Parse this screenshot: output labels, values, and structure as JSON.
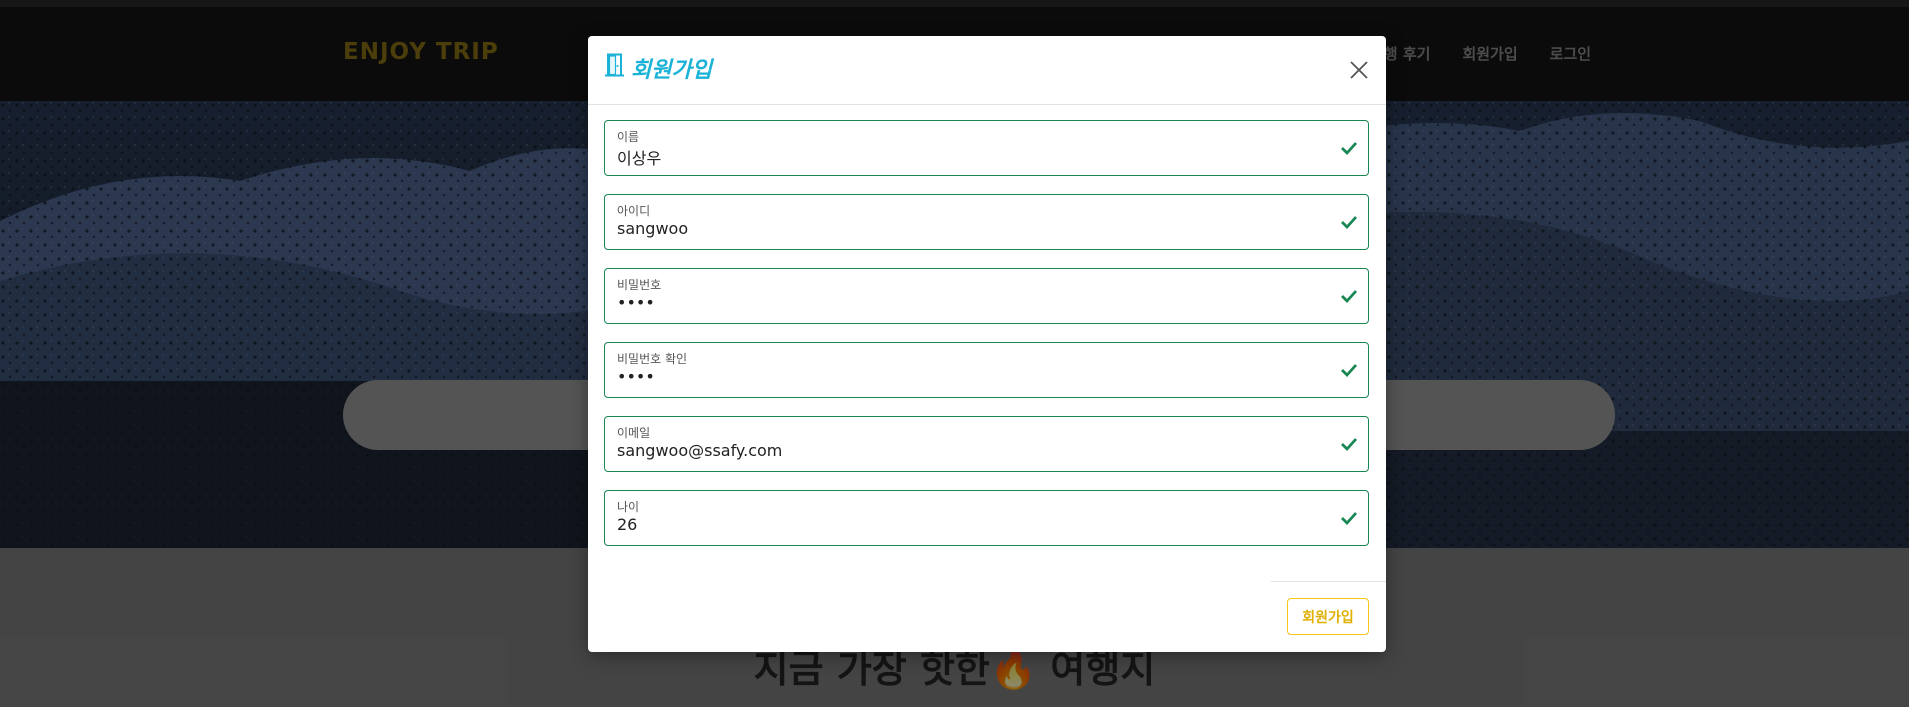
{
  "navbar": {
    "brand": "ENJOY TRIP",
    "links": [
      "여행 후기",
      "회원가입",
      "로그인"
    ]
  },
  "page": {
    "section_title": "지금 가장 핫한🔥 여행지"
  },
  "modal": {
    "title": "회원가입",
    "fields": [
      {
        "label": "이름",
        "value": "이상우"
      },
      {
        "label": "아이디",
        "value": "sangwoo"
      },
      {
        "label": "비밀번호",
        "value": "••••"
      },
      {
        "label": "비밀번호 확인",
        "value": "••••"
      },
      {
        "label": "이메일",
        "value": "sangwoo@ssafy.com"
      },
      {
        "label": "나이",
        "value": "26"
      }
    ],
    "submit_label": "회원가입"
  },
  "colors": {
    "accent": "#1ab2d6",
    "valid": "#198754",
    "submit": "#f5c518",
    "brand": "#8a7214"
  }
}
